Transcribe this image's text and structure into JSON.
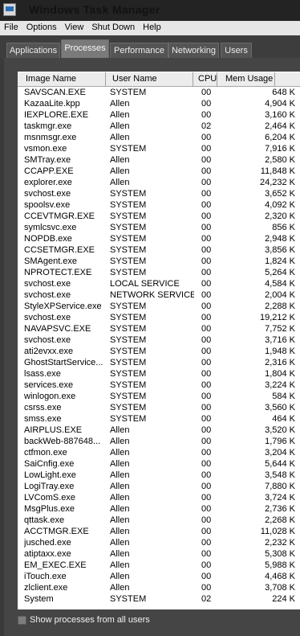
{
  "window": {
    "title": "Windows Task Manager"
  },
  "menu": [
    "File",
    "Options",
    "View",
    "Shut Down",
    "Help"
  ],
  "tabs": [
    {
      "label": "Applications",
      "active": false
    },
    {
      "label": "Processes",
      "active": true
    },
    {
      "label": "Performance",
      "active": false
    },
    {
      "label": "Networking",
      "active": false
    },
    {
      "label": "Users",
      "active": false
    }
  ],
  "columns": {
    "name": "Image Name",
    "user": "User Name",
    "cpu": "CPU",
    "mem": "Mem Usage"
  },
  "processes": [
    {
      "name": "SAVSCAN.EXE",
      "user": "SYSTEM",
      "cpu": "00",
      "mem": "648 K"
    },
    {
      "name": "KazaaLite.kpp",
      "user": "Allen",
      "cpu": "00",
      "mem": "4,904 K"
    },
    {
      "name": "IEXPLORE.EXE",
      "user": "Allen",
      "cpu": "00",
      "mem": "3,160 K"
    },
    {
      "name": "taskmgr.exe",
      "user": "Allen",
      "cpu": "02",
      "mem": "2,464 K"
    },
    {
      "name": "msnmsgr.exe",
      "user": "Allen",
      "cpu": "00",
      "mem": "6,204 K"
    },
    {
      "name": "vsmon.exe",
      "user": "SYSTEM",
      "cpu": "00",
      "mem": "7,916 K"
    },
    {
      "name": "SMTray.exe",
      "user": "Allen",
      "cpu": "00",
      "mem": "2,580 K"
    },
    {
      "name": "CCAPP.EXE",
      "user": "Allen",
      "cpu": "00",
      "mem": "11,848 K"
    },
    {
      "name": "explorer.exe",
      "user": "Allen",
      "cpu": "00",
      "mem": "24,232 K"
    },
    {
      "name": "svchost.exe",
      "user": "SYSTEM",
      "cpu": "00",
      "mem": "3,652 K"
    },
    {
      "name": "spoolsv.exe",
      "user": "SYSTEM",
      "cpu": "00",
      "mem": "4,092 K"
    },
    {
      "name": "CCEVTMGR.EXE",
      "user": "SYSTEM",
      "cpu": "00",
      "mem": "2,320 K"
    },
    {
      "name": "symlcsvc.exe",
      "user": "SYSTEM",
      "cpu": "00",
      "mem": "856 K"
    },
    {
      "name": "NOPDB.exe",
      "user": "SYSTEM",
      "cpu": "00",
      "mem": "2,948 K"
    },
    {
      "name": "CCSETMGR.EXE",
      "user": "SYSTEM",
      "cpu": "00",
      "mem": "3,856 K"
    },
    {
      "name": "SMAgent.exe",
      "user": "SYSTEM",
      "cpu": "00",
      "mem": "1,824 K"
    },
    {
      "name": "NPROTECT.EXE",
      "user": "SYSTEM",
      "cpu": "00",
      "mem": "5,264 K"
    },
    {
      "name": "svchost.exe",
      "user": "LOCAL SERVICE",
      "cpu": "00",
      "mem": "4,584 K"
    },
    {
      "name": "svchost.exe",
      "user": "NETWORK SERVICE",
      "cpu": "00",
      "mem": "2,004 K"
    },
    {
      "name": "StyleXPService.exe",
      "user": "SYSTEM",
      "cpu": "00",
      "mem": "2,288 K"
    },
    {
      "name": "svchost.exe",
      "user": "SYSTEM",
      "cpu": "00",
      "mem": "19,212 K"
    },
    {
      "name": "NAVAPSVC.EXE",
      "user": "SYSTEM",
      "cpu": "00",
      "mem": "7,752 K"
    },
    {
      "name": "svchost.exe",
      "user": "SYSTEM",
      "cpu": "00",
      "mem": "3,716 K"
    },
    {
      "name": "ati2evxx.exe",
      "user": "SYSTEM",
      "cpu": "00",
      "mem": "1,948 K"
    },
    {
      "name": "GhostStartService...",
      "user": "SYSTEM",
      "cpu": "00",
      "mem": "2,316 K"
    },
    {
      "name": "lsass.exe",
      "user": "SYSTEM",
      "cpu": "00",
      "mem": "1,804 K"
    },
    {
      "name": "services.exe",
      "user": "SYSTEM",
      "cpu": "00",
      "mem": "3,224 K"
    },
    {
      "name": "winlogon.exe",
      "user": "SYSTEM",
      "cpu": "00",
      "mem": "584 K"
    },
    {
      "name": "csrss.exe",
      "user": "SYSTEM",
      "cpu": "00",
      "mem": "3,560 K"
    },
    {
      "name": "smss.exe",
      "user": "SYSTEM",
      "cpu": "00",
      "mem": "464 K"
    },
    {
      "name": "AIRPLUS.EXE",
      "user": "Allen",
      "cpu": "00",
      "mem": "3,520 K"
    },
    {
      "name": "backWeb-887648...",
      "user": "Allen",
      "cpu": "00",
      "mem": "1,796 K"
    },
    {
      "name": "ctfmon.exe",
      "user": "Allen",
      "cpu": "00",
      "mem": "3,204 K"
    },
    {
      "name": "SaiCnfig.exe",
      "user": "Allen",
      "cpu": "00",
      "mem": "5,644 K"
    },
    {
      "name": "LowLight.exe",
      "user": "Allen",
      "cpu": "00",
      "mem": "3,548 K"
    },
    {
      "name": "LogiTray.exe",
      "user": "Allen",
      "cpu": "00",
      "mem": "7,880 K"
    },
    {
      "name": "LVComS.exe",
      "user": "Allen",
      "cpu": "00",
      "mem": "3,724 K"
    },
    {
      "name": "MsgPlus.exe",
      "user": "Allen",
      "cpu": "00",
      "mem": "2,736 K"
    },
    {
      "name": "qttask.exe",
      "user": "Allen",
      "cpu": "00",
      "mem": "2,268 K"
    },
    {
      "name": "ACCTMGR.EXE",
      "user": "Allen",
      "cpu": "00",
      "mem": "11,028 K"
    },
    {
      "name": "jusched.exe",
      "user": "Allen",
      "cpu": "00",
      "mem": "2,232 K"
    },
    {
      "name": "atiptaxx.exe",
      "user": "Allen",
      "cpu": "00",
      "mem": "5,308 K"
    },
    {
      "name": "EM_EXEC.EXE",
      "user": "Allen",
      "cpu": "00",
      "mem": "5,988 K"
    },
    {
      "name": "iTouch.exe",
      "user": "Allen",
      "cpu": "00",
      "mem": "4,468 K"
    },
    {
      "name": "zlclient.exe",
      "user": "Allen",
      "cpu": "00",
      "mem": "3,708 K"
    },
    {
      "name": "System",
      "user": "SYSTEM",
      "cpu": "02",
      "mem": "224 K"
    }
  ],
  "show_all": {
    "label": "Show processes from all users",
    "checked": false
  }
}
